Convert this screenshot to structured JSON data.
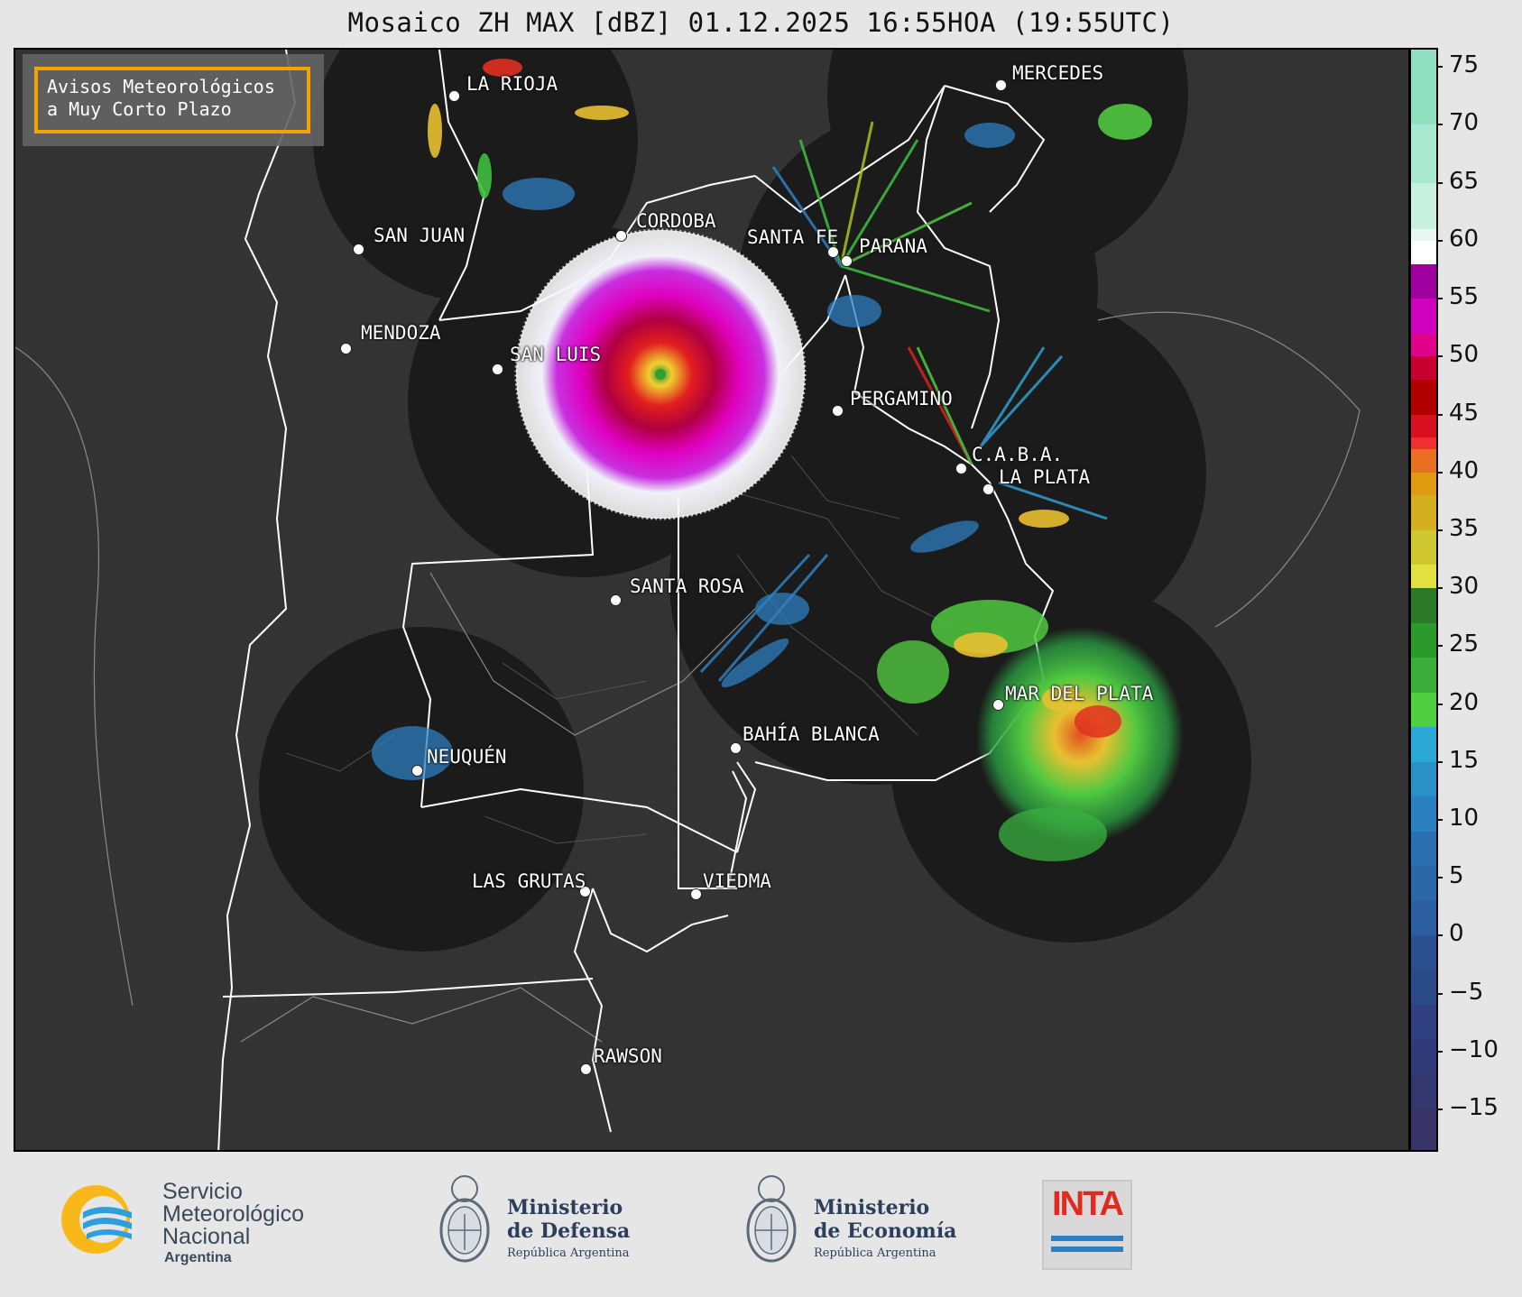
{
  "title": "Mosaico ZH MAX [dBZ] 01.12.2025 16:55HOA (19:55UTC)",
  "notice": {
    "line1": "Avisos Meteorológicos",
    "line2": "a Muy Corto Plazo",
    "border_color": "#f5a300"
  },
  "cities": [
    {
      "name": "LA RIOJA"
    },
    {
      "name": "MERCEDES"
    },
    {
      "name": "SAN JUAN"
    },
    {
      "name": "CORDOBA"
    },
    {
      "name": "SANTA FE"
    },
    {
      "name": "PARANA"
    },
    {
      "name": "MENDOZA"
    },
    {
      "name": "SAN LUIS"
    },
    {
      "name": "PERGAMINO"
    },
    {
      "name": "C.A.B.A."
    },
    {
      "name": "LA PLATA"
    },
    {
      "name": "SANTA ROSA"
    },
    {
      "name": "MAR DEL PLATA"
    },
    {
      "name": "BAHÍA BLANCA"
    },
    {
      "name": "NEUQUÉN"
    },
    {
      "name": "LAS GRUTAS"
    },
    {
      "name": "VIEDMA"
    },
    {
      "name": "RAWSON"
    }
  ],
  "colorbar": {
    "unit": "dBZ",
    "ticks": [
      "75",
      "70",
      "65",
      "60",
      "55",
      "50",
      "45",
      "40",
      "35",
      "30",
      "25",
      "20",
      "15",
      "10",
      "5",
      "0",
      "−5",
      "−10",
      "−15"
    ],
    "range": [
      -18.5,
      76.5
    ]
  },
  "footer": {
    "smn": {
      "line1": "Servicio",
      "line2": "Meteorológico",
      "line3": "Nacional",
      "line4": "Argentina"
    },
    "defensa": {
      "line1": "Ministerio",
      "line2": "de Defensa",
      "line3": "República Argentina"
    },
    "economia": {
      "line1": "Ministerio",
      "line2": "de Economía",
      "line3": "República Argentina"
    },
    "inta": {
      "label": "INTA"
    }
  }
}
